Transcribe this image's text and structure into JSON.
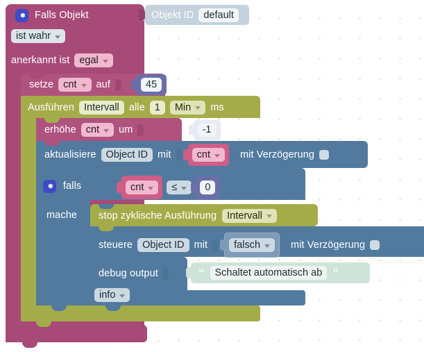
{
  "workspace": {
    "background": "#ffffff",
    "grid_dot_color": "#d8d8dd"
  },
  "colors": {
    "magenta": "#a74a77",
    "olive": "#a4ac4a",
    "blue": "#527a9e",
    "object_id_block": "#c3d2dc",
    "string_block": "#cfe4d9",
    "variable_block": "#cf5d87",
    "number_block": "#6a6fa8",
    "gear_icon": "#3d4bc4"
  },
  "blocks": {
    "trigger": {
      "gear_icon": "gear-icon",
      "title": "Falls Objekt",
      "object_id_label": "Objekt ID",
      "object_id_value": "default",
      "condition_dropdown": "ist wahr",
      "acknowledged_label": "anerkannt ist",
      "acknowledged_dropdown": "egal"
    },
    "set_var": {
      "keyword": "setze",
      "variable": "cnt",
      "preposition": "auf",
      "value": "45"
    },
    "interval": {
      "keyword": "Ausführen",
      "name_field": "Intervall",
      "every_label": "alle",
      "amount": "1",
      "unit_dropdown": "Min",
      "unit_suffix": "ms"
    },
    "increase": {
      "keyword": "erhöhe",
      "variable": "cnt",
      "preposition": "um",
      "value": "-1"
    },
    "update": {
      "keyword": "aktualisiere",
      "object_id": "Object ID",
      "with_label": "mit",
      "value_variable": "cnt",
      "delay_label": "mit Verzögerung",
      "delay_checked": false
    },
    "if_block": {
      "gear_icon": "gear-icon",
      "keyword": "falls",
      "left_operand": "cnt",
      "operator": "≤",
      "right_operand": "0",
      "do_label": "mache"
    },
    "stop_interval": {
      "keyword": "stop zyklische Ausführung",
      "target_dropdown": "Intervall"
    },
    "control": {
      "keyword": "steuere",
      "object_id": "Object ID",
      "with_label": "mit",
      "value_dropdown": "falsch",
      "delay_label": "mit Verzögerung",
      "delay_checked": false
    },
    "debug": {
      "keyword": "debug output",
      "text_value": "Schaltet automatisch ab",
      "quote_open": "“",
      "quote_close": "”",
      "severity_dropdown": "info"
    }
  }
}
